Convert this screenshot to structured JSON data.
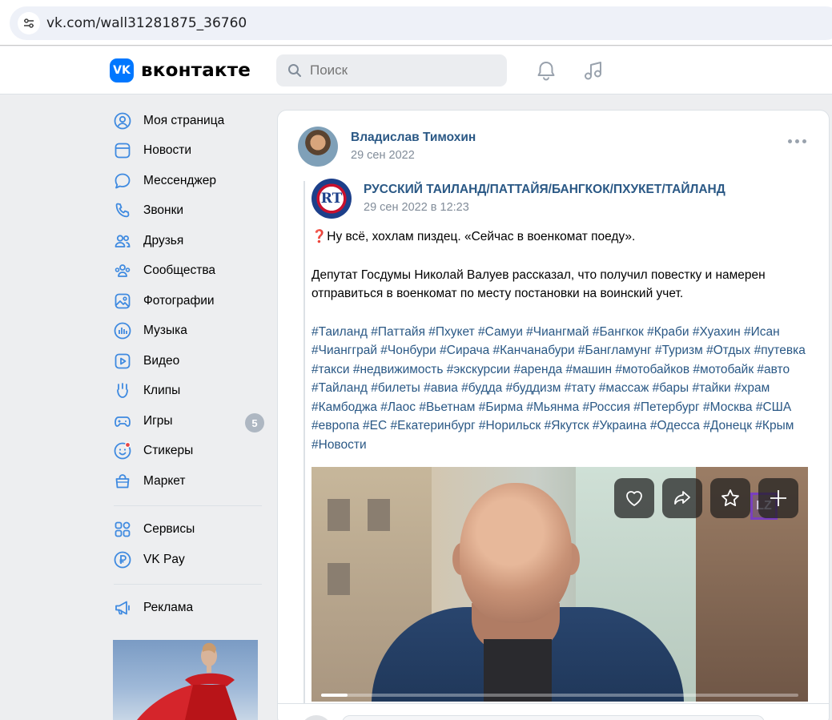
{
  "browser": {
    "url": "vk.com/wall31281875_36760",
    "site_settings_icon": "tune-icon"
  },
  "header": {
    "logo_mark": "VK",
    "logo_text": "вконтакте",
    "search_placeholder": "Поиск",
    "icons": [
      "bell-icon",
      "music-note-icon"
    ],
    "brand_color": "#0077ff"
  },
  "sidebar": {
    "items": [
      {
        "label": "Моя страница",
        "icon": "user-circle-icon"
      },
      {
        "label": "Новости",
        "icon": "news-icon"
      },
      {
        "label": "Мессенджер",
        "icon": "message-icon"
      },
      {
        "label": "Звонки",
        "icon": "phone-icon"
      },
      {
        "label": "Друзья",
        "icon": "friends-icon"
      },
      {
        "label": "Сообщества",
        "icon": "communities-icon"
      },
      {
        "label": "Фотографии",
        "icon": "photo-icon"
      },
      {
        "label": "Музыка",
        "icon": "music-icon"
      },
      {
        "label": "Видео",
        "icon": "video-icon"
      },
      {
        "label": "Клипы",
        "icon": "clips-icon"
      },
      {
        "label": "Игры",
        "icon": "gamepad-icon",
        "badge": "5"
      },
      {
        "label": "Стикеры",
        "icon": "sticker-icon"
      },
      {
        "label": "Маркет",
        "icon": "market-bag-icon"
      }
    ],
    "services": [
      {
        "label": "Сервисы",
        "icon": "services-grid-icon"
      },
      {
        "label": "VK Pay",
        "icon": "vkpay-icon"
      }
    ],
    "ads": [
      {
        "label": "Реклама",
        "icon": "megaphone-icon"
      }
    ]
  },
  "post": {
    "author": "Владислав Тимохин",
    "date": "29 сен 2022",
    "repost": {
      "group_name": "РУССКИЙ ТАИЛАНД/ПАТТАЙЯ/БАНГКОК/ПХУКЕТ/ТАЙЛАНД",
      "group_avatar_text": "RT",
      "date": "29 сен 2022 в 12:23",
      "text_line1": "❓Ну всё, хохлам пиздец. «Сейчас в военкомат поеду».",
      "text_line2": "Депутат Госдумы Николай Валуев рассказал, что получил повестку и намерен отправиться в военкомат по месту постановки на воинский учет.",
      "hashtags": "#Таиланд #Паттайя #Пхукет #Самуи #Чиангмай #Бангкок #Краби #Хуахин #Исан #Чиангграй #Чонбури #Сирача #Канчанабури #Бангламунг #Туризм #Отдых #путевка #такси #недвижимость #экскурсии #аренда #машин #мотобайков #мотобайк #авто #Тайланд #билеты #авиа #будда #буддизм #тату #массаж #бары #тайки #храм #Камбоджа #Лаос #Вьетнам #Бирма #Мьянма #Россия #Петербург #Москва #США #европа #ЕС #Екатеринбург #Норильск #Якутск #Украина #Одесса #Донецк #Крым #Новости"
    },
    "video": {
      "watermark": "LZ",
      "progress": 0.055,
      "actions": [
        "heart-icon",
        "share-icon",
        "star-icon",
        "plus-icon"
      ]
    }
  }
}
